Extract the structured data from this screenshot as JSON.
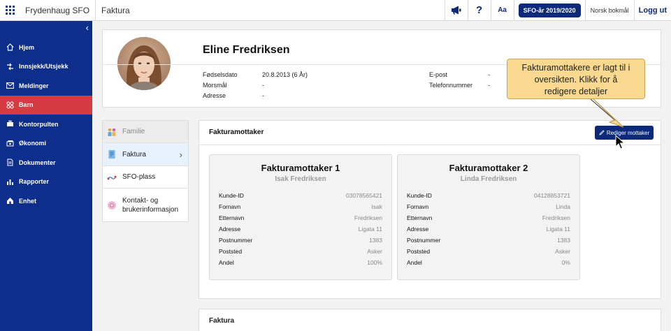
{
  "topbar": {
    "app_name": "Frydenhaug SFO",
    "page_name": "Faktura",
    "font_size_label": "Aa",
    "question_icon": "?",
    "sfo_year": "SFO-år 2019/2020",
    "language": "Norsk bokmål",
    "logout": "Logg ut"
  },
  "sidebar": {
    "items": [
      {
        "label": "Hjem",
        "icon": "home-icon"
      },
      {
        "label": "Innsjekk/Utsjekk",
        "icon": "checkin-icon"
      },
      {
        "label": "Meldinger",
        "icon": "mail-icon"
      },
      {
        "label": "Barn",
        "icon": "children-icon",
        "active": true
      },
      {
        "label": "Kontorpulten",
        "icon": "desk-icon"
      },
      {
        "label": "Økonomi",
        "icon": "money-icon"
      },
      {
        "label": "Dokumenter",
        "icon": "document-icon"
      },
      {
        "label": "Rapporter",
        "icon": "chart-icon"
      },
      {
        "label": "Enhet",
        "icon": "unit-icon"
      }
    ]
  },
  "profile": {
    "name": "Eline Fredriksen",
    "birth_label": "Fødselsdato",
    "birth_value": "20.8.2013 (6 År)",
    "lang_label": "Morsmål",
    "lang_value": "-",
    "address_label": "Adresse",
    "address_value": "-",
    "email_label": "E-post",
    "email_value": "-",
    "phone_label": "Telefonnummer",
    "phone_value": "-"
  },
  "left_menu": {
    "items": [
      {
        "label": "Familie",
        "state": "disabled"
      },
      {
        "label": "Faktura",
        "state": "selected"
      },
      {
        "label": "SFO-plass",
        "state": "normal"
      },
      {
        "label": "Kontakt- og brukerinformasjon",
        "state": "normal"
      }
    ],
    "chevron": "›"
  },
  "panel": {
    "title": "Fakturamottaker",
    "edit_button": "Rediger mottaker",
    "recipients": [
      {
        "title": "Fakturamottaker 1",
        "name": "Isak Fredriksen",
        "rows": [
          {
            "k": "Kunde-ID",
            "v": "03078565421"
          },
          {
            "k": "Fornavn",
            "v": "Isak"
          },
          {
            "k": "Etternavn",
            "v": "Fredriksen"
          },
          {
            "k": "Adresse",
            "v": "Ligata 11"
          },
          {
            "k": "Postnummer",
            "v": "1383"
          },
          {
            "k": "Poststed",
            "v": "Asker"
          },
          {
            "k": "Andel",
            "v": "100%"
          }
        ]
      },
      {
        "title": "Fakturamottaker 2",
        "name": "Linda Fredriksen",
        "rows": [
          {
            "k": "Kunde-ID",
            "v": "04128853721"
          },
          {
            "k": "Fornavn",
            "v": "Linda"
          },
          {
            "k": "Etternavn",
            "v": "Fredriksen"
          },
          {
            "k": "Adresse",
            "v": "Ligata 11"
          },
          {
            "k": "Postnummer",
            "v": "1383"
          },
          {
            "k": "Poststed",
            "v": "Asker"
          },
          {
            "k": "Andel",
            "v": "0%"
          }
        ]
      }
    ]
  },
  "faktura_panel": {
    "title": "Faktura"
  },
  "tooltip": {
    "line1": "Fakturamottakere er lagt til i",
    "line2": "oversikten. Klikk for å",
    "line3": "redigere detaljer"
  },
  "colors": {
    "brand": "#0d2e8a",
    "active": "#d63b43",
    "tooltip": "#f8d98f"
  }
}
